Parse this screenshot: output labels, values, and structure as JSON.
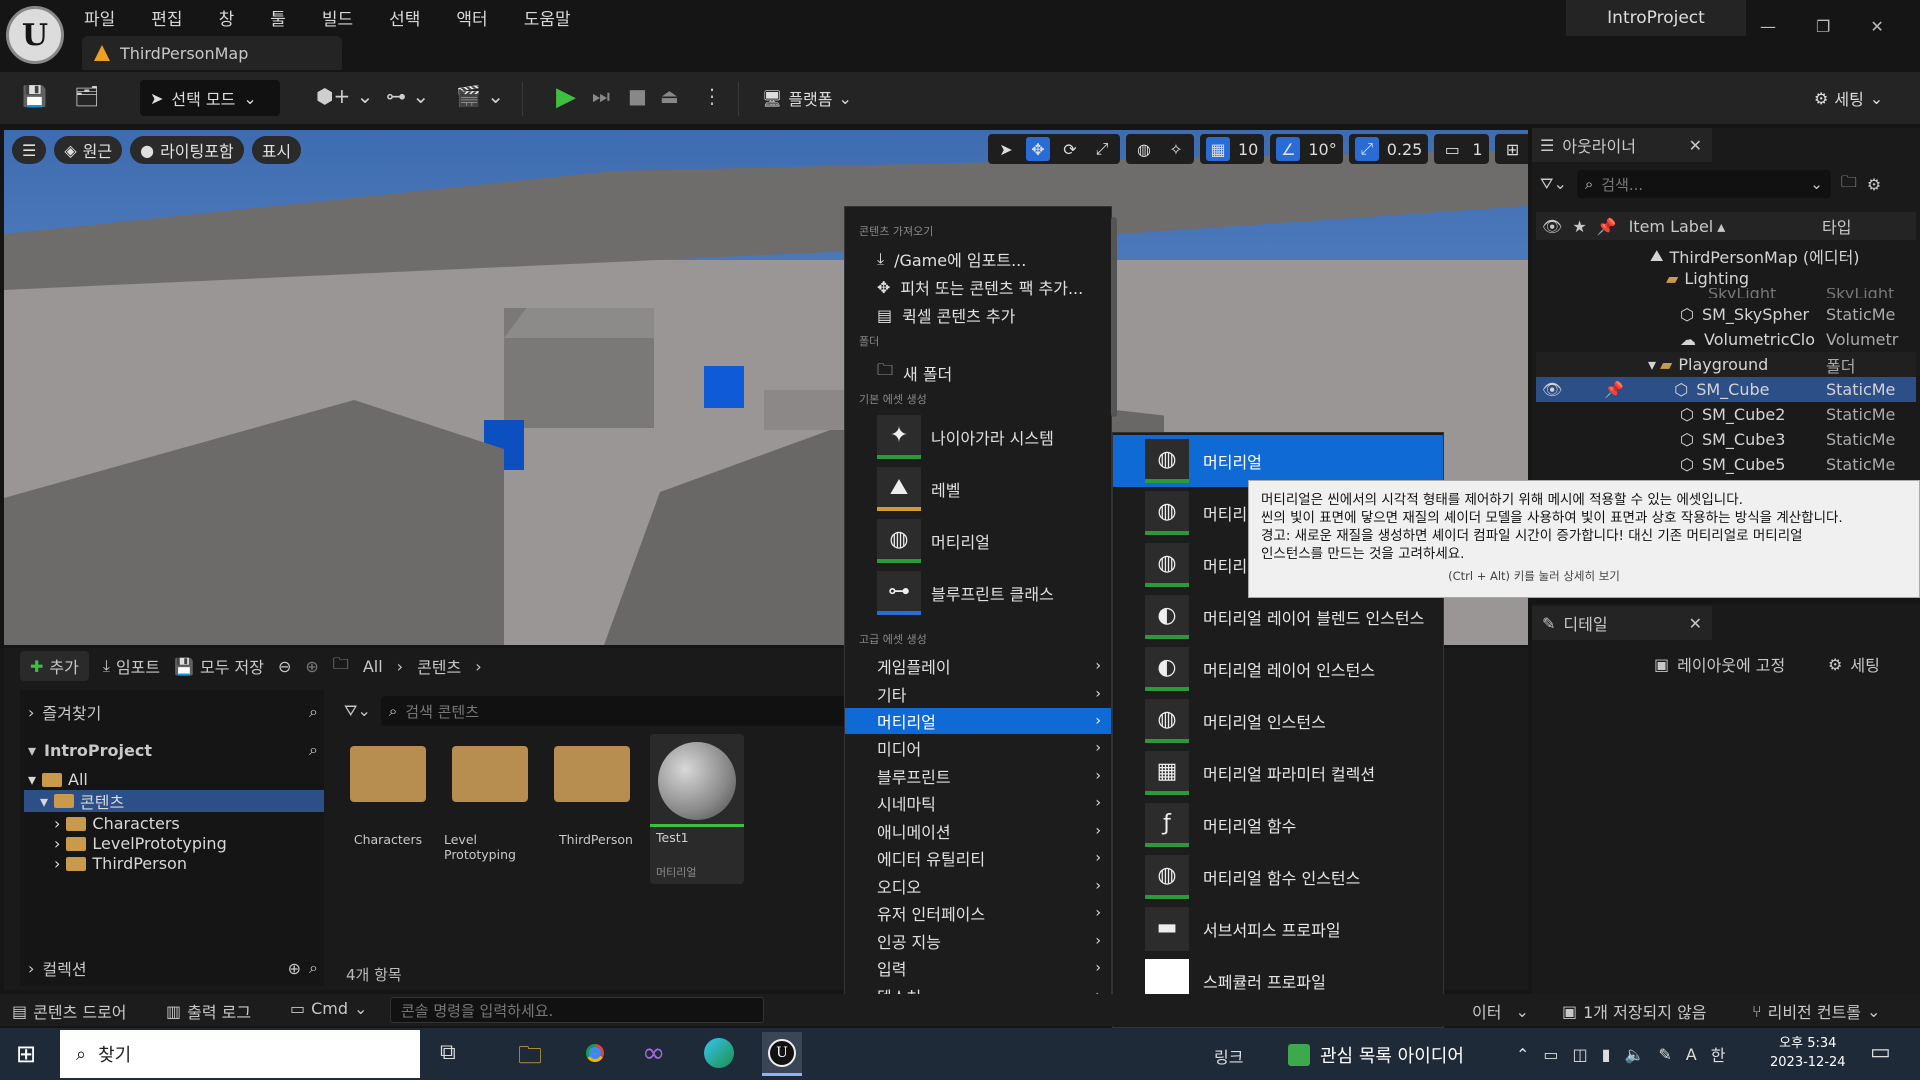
{
  "app": {
    "logo_text": "U",
    "project": "IntroProject",
    "map_tab": "ThirdPersonMap",
    "window_buttons": [
      "—",
      "❐",
      "✕"
    ]
  },
  "menubar": [
    "파일",
    "편집",
    "창",
    "툴",
    "빌드",
    "선택",
    "액터",
    "도움말"
  ],
  "toolbar": {
    "select_mode": "선택 모드",
    "platform": "플랫폼",
    "settings": "세팅"
  },
  "viewport": {
    "perspective": "원근",
    "lighting": "라이팅포함",
    "show": "표시",
    "grid": "10",
    "rotation": "10°",
    "scale": "0.25",
    "camera": "1"
  },
  "outliner": {
    "tab": "아웃라이너",
    "search_placeholder": "검색...",
    "col_label": "Item Label",
    "col_type": "타입",
    "rows": [
      {
        "label": "ThirdPersonMap (에디터)",
        "type": ""
      },
      {
        "label": "Lighting",
        "type": ""
      },
      {
        "label": "SkyLight",
        "type": "SkyLight"
      },
      {
        "label": "SM_SkySpher",
        "type": "StaticMe"
      },
      {
        "label": "VolumetricClo",
        "type": "Volumetr"
      },
      {
        "label": "Playground",
        "type": "폴더"
      },
      {
        "label": "SM_Cube",
        "type": "StaticMe"
      },
      {
        "label": "SM_Cube2",
        "type": "StaticMe"
      },
      {
        "label": "SM_Cube3",
        "type": "StaticMe"
      },
      {
        "label": "SM_Cube5",
        "type": "StaticMe"
      }
    ]
  },
  "tooltip": {
    "lines": [
      "머티리얼은 씬에서의 시각적 형태를 제어하기 위해 메시에 적용할 수 있는 에셋입니다.",
      "씬의 빛이 표면에 닿으면 재질의 셰이더 모델을 사용하여 빛이 표면과 상호 작용하는 방식을 계산합니다.",
      "경고: 새로운 재질을 생성하면 셰이더 컴파일 시간이 증가합니다! 대신 기존 머티리얼로 머티리얼",
      "인스턴스를 만드는 것을 고려하세요."
    ],
    "hint": "(Ctrl + Alt) 키를 눌러 상세히 보기"
  },
  "details": {
    "tab": "디테일",
    "lock_layout": "레이아웃에 고정",
    "settings": "세팅"
  },
  "drawer": {
    "add": "추가",
    "import": "임포트",
    "save_all": "모두 저장",
    "path_all": "All",
    "path_content": "콘텐츠",
    "favorites": "즐겨찾기",
    "project": "IntroProject",
    "collections": "컬렉션",
    "search_placeholder": "검색 콘텐츠",
    "item_count": "4개 항목",
    "tree": [
      "All",
      "콘텐츠",
      "Characters",
      "LevelPrototyping",
      "ThirdPerson"
    ],
    "tiles": [
      {
        "label": "Characters"
      },
      {
        "label": "Level Prototyping"
      },
      {
        "label": "ThirdPerson"
      },
      {
        "label": "Test1",
        "sub": "머티리얼"
      }
    ]
  },
  "menu1": {
    "h_import": "콘텐츠 가져오기",
    "import_game": "/Game에 임포트...",
    "add_feature": "피처 또는 콘텐츠 팩 추가...",
    "quixel": "퀵셀 콘텐츠 추가",
    "h_folder": "폴더",
    "new_folder": "새 폴더",
    "h_basic": "기본 에셋 생성",
    "niagara": "나이아가라 시스템",
    "level": "레벨",
    "material": "머티리얼",
    "blueprint_class": "블루프린트 클래스",
    "h_advanced": "고급 에셋 생성",
    "subs": [
      "게임플레이",
      "기타",
      "머티리얼",
      "미디어",
      "블루프린트",
      "시네마틱",
      "애니메이션",
      "에디터 유틸리티",
      "오디오",
      "유저 인터페이스",
      "인공 지능",
      "입력",
      "텍스처"
    ]
  },
  "menu2": {
    "items": [
      "머티리얼",
      "머티리얼",
      "머티리얼",
      "머티리얼 레이어 블렌드 인스턴스",
      "머티리얼 레이어 인스턴스",
      "머티리얼 인스턴스",
      "머티리얼 파라미터 컬렉션",
      "머티리얼 함수",
      "머티리얼 함수 인스턴스",
      "서브서피스 프로파일",
      "스페큘러 프로파일"
    ]
  },
  "statusbar": {
    "content_drawer": "콘텐츠 드로어",
    "output_log": "출력 로그",
    "cmd": "Cmd",
    "console_placeholder": "콘솔 명령을 입력하세요.",
    "partial_right": "이터",
    "unsaved": "1개 저장되지 않음",
    "revision": "리비전 컨트롤"
  },
  "taskbar": {
    "search": "찾기",
    "link": "링크",
    "news": "관심 목록 아이디어",
    "time": "오후 5:34",
    "date": "2023-12-24",
    "ime": "A",
    "lang": "한"
  }
}
